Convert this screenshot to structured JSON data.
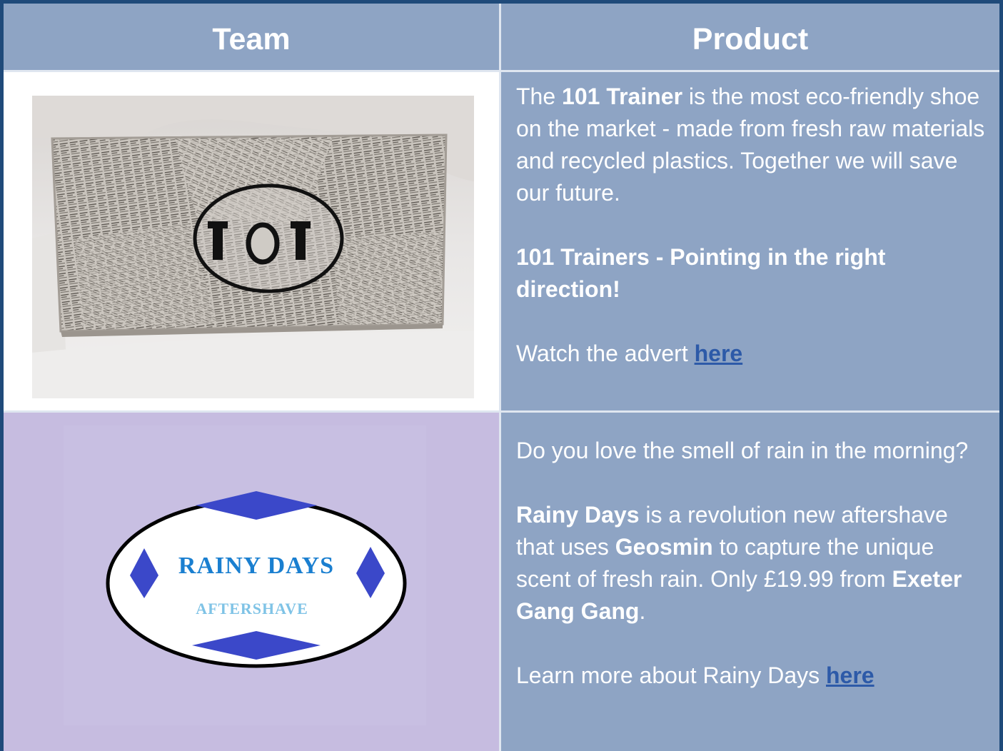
{
  "table": {
    "headers": {
      "team": "Team",
      "product": "Product"
    },
    "rows": [
      {
        "team_image": "101 trainer shoebox photo",
        "box_logo_text": "101",
        "product": {
          "p1_pre": "The ",
          "p1_bold": "101 Trainer",
          "p1_post": " is the most eco-friendly shoe on the market - made from fresh raw materials and recycled plastics. Together we will save our future.",
          "slogan": "101 Trainers - Pointing in the right direction!",
          "link_pre": "Watch the advert ",
          "link_text": "here"
        }
      },
      {
        "team_image": "rainy days aftershave logo",
        "logo_title": "RAINY DAYS",
        "logo_subtitle": "AFTERSHAVE",
        "product": {
          "p1": "Do you love the smell of rain in the morning?",
          "p2_bold1": "Rainy Days",
          "p2_mid1": " is a revolution new aftershave that uses ",
          "p2_bold2": "Geosmin",
          "p2_mid2": " to capture the unique scent of fresh rain. Only £19.99 from ",
          "p2_bold3": "Exeter Gang Gang",
          "p2_end": ".",
          "link_pre": "Learn more about Rainy Days ",
          "link_text": "here"
        }
      }
    ]
  },
  "colors": {
    "header_bg": "#8ea4c4",
    "product_bg": "#8ea4c4",
    "team2_bg": "#c6bce0",
    "link": "#2d5aa8",
    "logo_title": "#1a7fd0",
    "logo_subtitle": "#7fc3e6",
    "diamond": "#3b48c9"
  }
}
